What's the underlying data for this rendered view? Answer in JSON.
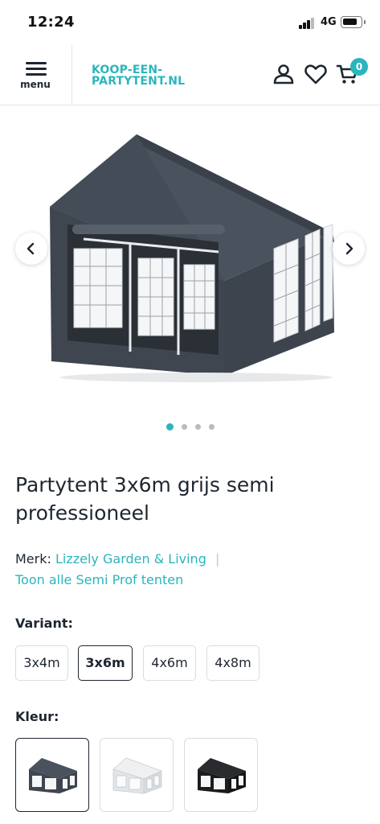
{
  "status": {
    "time": "12:24",
    "network": "4G"
  },
  "header": {
    "menu_label": "menu",
    "logo_line1": "KOOP-EEN-",
    "logo_line2": "PARTYTENT.NL",
    "cart_count": "0",
    "brand_color": "#2bb5bd"
  },
  "gallery": {
    "image_count": 4,
    "active_index": 0,
    "icons": {
      "prev": "chevron-left-icon",
      "next": "chevron-right-icon"
    }
  },
  "product": {
    "title": "Partytent 3x6m grijs semi professioneel",
    "brand_prefix": "Merk:",
    "brand_name": "Lizzely Garden & Living",
    "separator": "|",
    "category_link": "Toon alle Semi Prof tenten"
  },
  "variant": {
    "label": "Variant:",
    "options": [
      "3x4m",
      "3x6m",
      "4x6m",
      "4x8m"
    ],
    "selected": "3x6m"
  },
  "color": {
    "label": "Kleur:",
    "swatches": [
      {
        "name": "grijs",
        "hex": "#3e4651",
        "selected": true
      },
      {
        "name": "wit",
        "hex": "#e9ecee",
        "selected": false
      },
      {
        "name": "zwart",
        "hex": "#1c1c1e",
        "selected": false
      }
    ]
  }
}
